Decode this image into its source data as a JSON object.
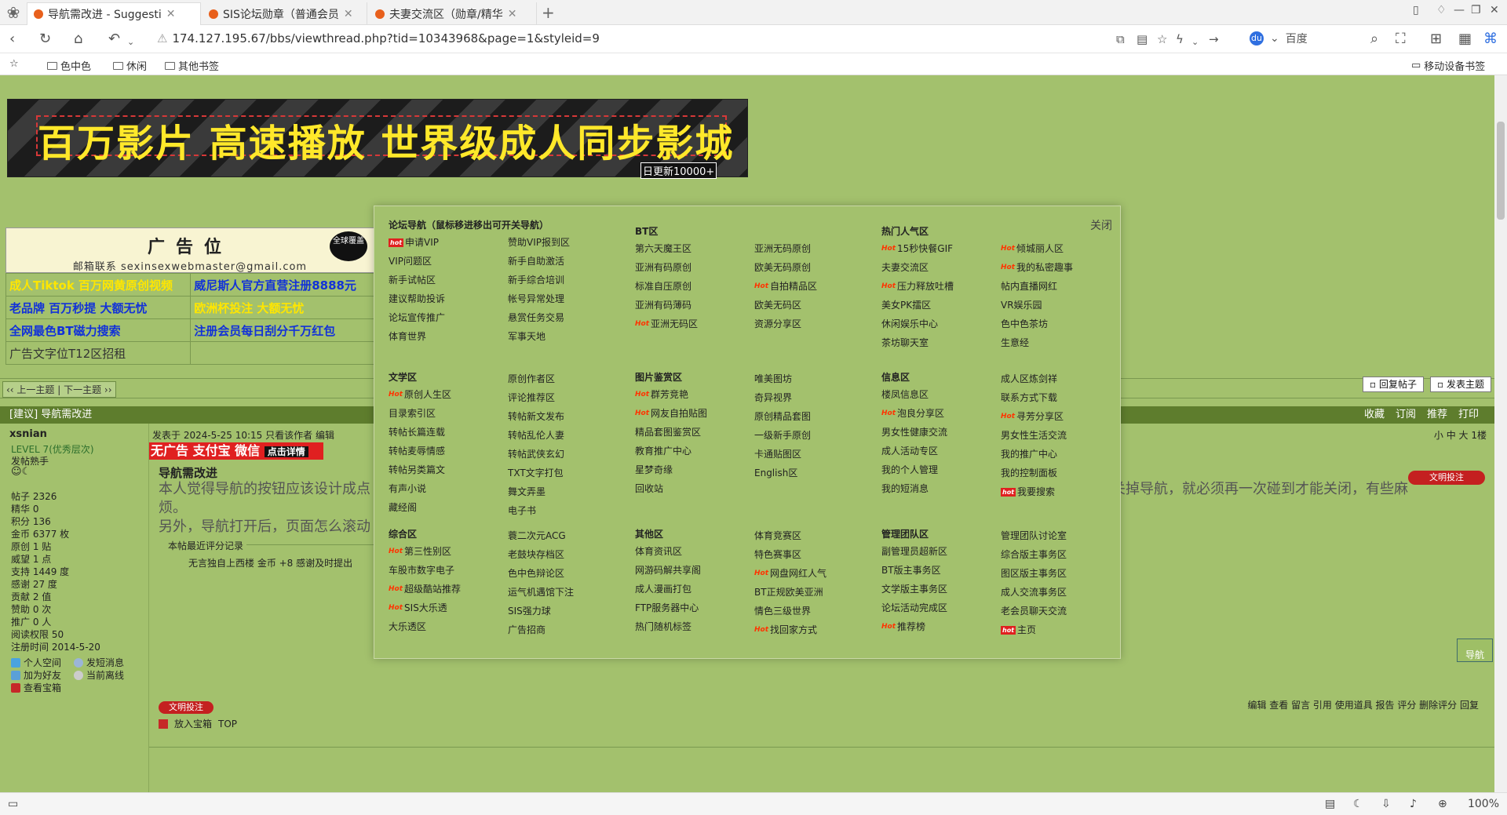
{
  "browser": {
    "tabs": [
      {
        "title": "导航需改进 - Suggesti"
      },
      {
        "title": "SIS论坛勋章（普通会员"
      },
      {
        "title": "夫妻交流区（勋章/精华"
      }
    ],
    "url": "174.127.195.67/bbs/viewthread.php?tid=10343968&page=1&styleid=9",
    "search_engine": "百度",
    "bookmarks": [
      "色中色",
      "休闲",
      "其他书签"
    ],
    "mobile_bookmarks": "移动设备书签",
    "zoom": "100%"
  },
  "banner": {
    "text": "百万影片 高速播放 世界级成人同步影城",
    "badge": "日更新10000+"
  },
  "ad": {
    "title": "广告位",
    "email": "邮箱联系 sexinsexwebmaster@gmail.com",
    "badge": "全球覆盖",
    "rows": [
      [
        "成人Tiktok 百万网黄原创视频",
        "威尼斯人官方直营注册8888元"
      ],
      [
        "老品牌 百万秒提 大额无忧",
        "欧洲杯投注 大额无忧"
      ],
      [
        "全网最色BT磁力搜索",
        "注册会员每日刮分千万红包"
      ],
      [
        "广告文字位T12区招租",
        ""
      ]
    ]
  },
  "thread": {
    "prevnext": "‹‹ 上一主题 | 下一主题 ››",
    "reply_label": "回复帖子",
    "newtopic_label": "发表主题",
    "title": "[建议] 导航需改进",
    "actions": [
      "收藏",
      "订阅",
      "推荐",
      "打印"
    ]
  },
  "user": {
    "name": "xsnian",
    "level": "LEVEL 7(优秀层次)",
    "title": "发帖熟手",
    "stats": [
      "帖子 2326",
      "精华 0",
      "积分 136",
      "金币 6377 枚",
      "原创 1 贴",
      "威望 1 点",
      "支持 1449 度",
      "感谢 27 度",
      "贡献 2 值",
      "赞助 0 次",
      "推广 0 人",
      "阅读权限 50",
      "注册时间 2014-5-20"
    ],
    "links": [
      "个人空间",
      "发短消息",
      "加为好友",
      "当前离线",
      "查看宝箱"
    ]
  },
  "post": {
    "meta": "发表于 2024-5-25 10:15  只看该作者  编辑",
    "size": "小 中 大  1楼",
    "noad": "无广告 支付宝 微信",
    "noad_small": "点击详情",
    "heading": "导航需改进",
    "body_line1": "本人觉得导航的按钮应该设计成点",
    "body_line1_end": "而且要关掉导航，就必须再一次碰到才能关闭，有些麻",
    "body_line2": "烦。",
    "body_line3": "另外，导航打开后，页面怎么滚动",
    "rating_title": "本帖最近评分记录",
    "rating_row": "无言独自上西楼    金币 +8    感谢及时提出",
    "badge": "文明投注",
    "footer_left": [
      "放入宝箱",
      "TOP"
    ],
    "footer_right": "编辑 查看 留言 引用 使用道具 报告 评分 删除评分 回复",
    "nav_btn": "导航"
  },
  "navpanel": {
    "close": "关闭",
    "forum_head": "论坛导航（鼠标移进移出可开关导航）",
    "forum_a": [
      "申请VIP",
      "VIP问题区",
      "新手试帖区",
      "建议帮助投诉",
      "论坛宣传推广",
      "体育世界"
    ],
    "forum_b": [
      "赞助VIP报到区",
      "新手自助激活",
      "新手综合培训",
      "帐号异常处理",
      "悬赏任务交易",
      "军事天地"
    ],
    "bt_head": "BT区",
    "bt_a": [
      "第六天魔王区",
      "亚洲有码原创",
      "标准自压原创",
      "亚洲有码薄码",
      "亚洲无码区"
    ],
    "bt_b": [
      "亚洲无码原创",
      "欧美无码原创",
      "自拍精品区",
      "欧美无码区",
      "资源分享区"
    ],
    "hot_head": "热门人气区",
    "hot_a": [
      "15秒快餐GIF",
      "夫妻交流区",
      "压力释放吐槽",
      "美女PK擂区",
      "休闲娱乐中心",
      "茶坊聊天室"
    ],
    "hot_b": [
      "倾城丽人区",
      "我的私密趣事",
      "帖内直播网红",
      "VR娱乐园",
      "色中色茶坊",
      "生意经"
    ],
    "lit_head": "文学区",
    "lit_a": [
      "原创人生区",
      "目录索引区",
      "转帖长篇连载",
      "转帖麦辱情感",
      "转帖另类篇文",
      "有声小说",
      "藏经阁"
    ],
    "lit_b": [
      "原创作者区",
      "评论推荐区",
      "转帖新文发布",
      "转帖乱伦人妻",
      "转帖武侠玄幻",
      "TXT文字打包",
      "舞文弄墨",
      "电子书"
    ],
    "pic_head": "图片鉴赏区",
    "pic_a": [
      "群芳竞艳",
      "网友自拍贴图",
      "精品套图鉴赏区",
      "教育推广中心",
      "星梦奇缘",
      "回收站"
    ],
    "pic_b": [
      "唯美图坊",
      "奇异视界",
      "原创精品套图",
      "一级新手原创",
      "卡通贴图区",
      "English区"
    ],
    "info_head": "信息区",
    "info_a": [
      "楼凤信息区",
      "泡良分享区",
      "男女性健康交流",
      "成人活动专区",
      "我的个人管理",
      "我的短消息"
    ],
    "info_b": [
      "成人区炼剑祥",
      "联系方式下载",
      "寻芳分享区",
      "男女性生活交流",
      "我的推广中心",
      "我的控制面板",
      "我要搜索"
    ],
    "misc_head": "综合区",
    "misc_a": [
      "第三性别区",
      "车股市数字电子",
      "超级酷站推荐",
      "SIS大乐透",
      "大乐透区"
    ],
    "misc_b": [
      "蓑二次元ACG",
      "老鼓块存档区",
      "色中色辩论区",
      "运气机遇馆下注",
      "SIS强力球",
      "广告招商"
    ],
    "other_head": "其他区",
    "other_a": [
      "体育资讯区",
      "网游码解共享阁",
      "成人漫画打包",
      "FTP服务器中心",
      "热门随机标签"
    ],
    "other_b": [
      "体育竞赛区",
      "特色赛事区",
      "网盘网红人气",
      "BT正规欧美亚洲",
      "情色三级世界",
      "找回家方式"
    ],
    "admin_head": "管理团队区",
    "admin_a": [
      "副管理员超新区",
      "BT版主事务区",
      "文学版主事务区",
      "论坛活动完成区",
      "推荐榜"
    ],
    "admin_b": [
      "管理团队讨论室",
      "综合版主事务区",
      "图区版主事务区",
      "成人交流事务区",
      "老会员聊天交流",
      "主页"
    ]
  }
}
